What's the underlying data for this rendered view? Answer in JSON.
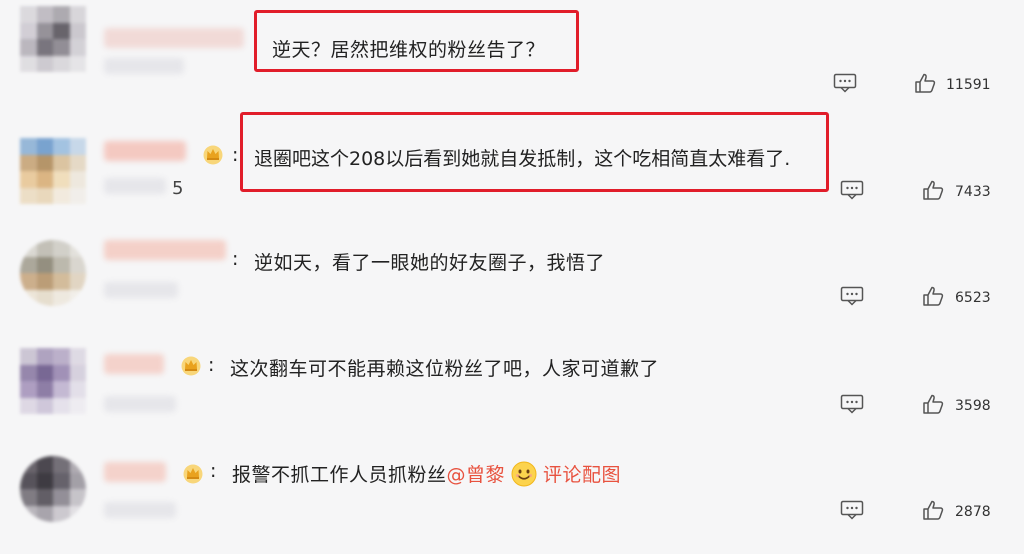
{
  "comments": [
    {
      "text": "逆天？居然把维权的粉丝告了？",
      "likes": "11591"
    },
    {
      "text": "退圈吧这个208以后看到她就自发抵制，这个吃相简直太难看了.",
      "likes": "7433",
      "username_suffix": "5"
    },
    {
      "text": "逆如天，看了一眼她的好友圈子，我悟了",
      "likes": "6523"
    },
    {
      "text": "这次翻车可不能再赖这位粉丝了吧，人家可道歉了",
      "likes": "3598"
    },
    {
      "text_before": "报警不抓工作人员抓粉丝",
      "mention": "@曾黎",
      "pic_link": "评论配图",
      "likes": "2878"
    }
  ],
  "icons": {
    "reply": "reply-comment-icon",
    "like": "thumbs-up-icon",
    "crown": "crown-badge-icon",
    "emoji": "smile-emoji-icon"
  },
  "colors": {
    "highlight": "#e11d2a",
    "mention": "#e8523f",
    "text": "#222222"
  }
}
